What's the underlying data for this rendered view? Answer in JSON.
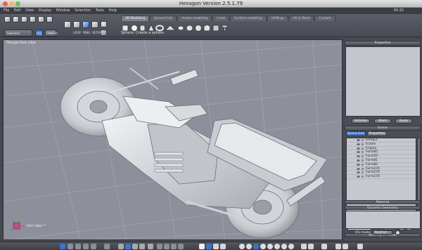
{
  "window": {
    "title": "Hexagon Version 2.5.1.79"
  },
  "menubar": {
    "items": [
      "File",
      "Edit",
      "View",
      "Display",
      "Window",
      "Selection",
      "Tools",
      "Help"
    ],
    "clock": "04:32"
  },
  "toolbar": {
    "tabs": [
      "3D Modeling",
      "Second Life",
      "Vertex modeling",
      "Lines",
      "Surface modeling",
      "UVWrap",
      "UV & Paint",
      "Custom"
    ],
    "active_tab": "3D Modeling",
    "hint": "Sphere: Create a sphere",
    "selection_label": "Selection",
    "snap_label": "OBJ",
    "camera_label": "CAMERA",
    "loop_label": "LOOP",
    "ring_label": "RING",
    "setup_label": "SETUP"
  },
  "viewport": {
    "label": "Perspective view",
    "axis_caption": "hell rider *"
  },
  "right_panel": {
    "properties_title": "Properties",
    "validate_label": "Validate",
    "abort_label": "Abort",
    "apply_label": "Apply",
    "scene_title": "Scene",
    "scene_tree_tab": "Scene tree",
    "properties_tab": "Properties",
    "scene_items": [
      "Group3",
      "Frame",
      "Engine",
      "Form85",
      "Form50",
      "Form81",
      "Form84",
      "Form270",
      "Form270",
      "Form270"
    ],
    "select_label": "Select",
    "shading_title": "Shading & Motion",
    "material_title": "Material",
    "dynamic_geometry_title": "Dynamic Geometry",
    "dg_mode_label": "DG mode:",
    "dg_mode_value": "Restrict"
  },
  "colors": {
    "viewport_bg": "#8d909a",
    "panel_bg": "#4a4d55",
    "accent": "#3c74c8",
    "model": "#e6e7ec"
  }
}
